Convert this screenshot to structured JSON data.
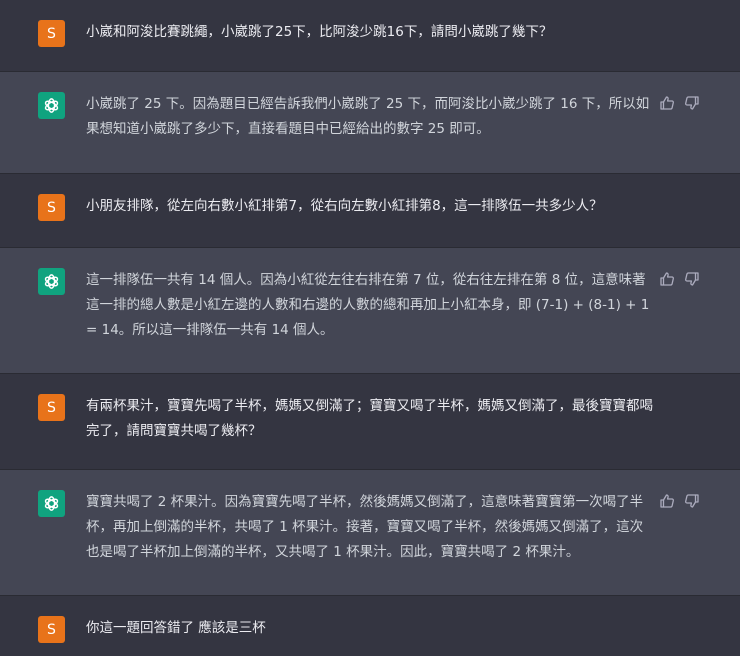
{
  "conversation": {
    "messages": [
      {
        "role": "user",
        "avatar_letter": "S",
        "avatar_color": "#e8731a",
        "text": "小崴和阿浚比賽跳繩，小崴跳了25下，比阿浚少跳16下，請問小崴跳了幾下？"
      },
      {
        "role": "assistant",
        "avatar_icon": "openai-logo-icon",
        "avatar_color": "#10a37f",
        "text": "小崴跳了 25 下。因為題目已經告訴我們小崴跳了 25 下，而阿浚比小崴少跳了 16 下，所以如果想知道小崴跳了多少下，直接看題目中已經給出的數字 25 即可。"
      },
      {
        "role": "user",
        "avatar_letter": "S",
        "avatar_color": "#e8731a",
        "text": "小朋友排隊，從左向右數小紅排第7，從右向左數小紅排第8，這一排隊伍一共多少人？"
      },
      {
        "role": "assistant",
        "avatar_icon": "openai-logo-icon",
        "avatar_color": "#10a37f",
        "text": "這一排隊伍一共有 14 個人。因為小紅從左往右排在第 7 位，從右往左排在第 8 位，這意味著這一排的總人數是小紅左邊的人數和右邊的人數的總和再加上小紅本身，即 (7-1) + (8-1) + 1 = 14。所以這一排隊伍一共有 14 個人。"
      },
      {
        "role": "user",
        "avatar_letter": "S",
        "avatar_color": "#e8731a",
        "text": "有兩杯果汁，寶寶先喝了半杯，媽媽又倒滿了；寶寶又喝了半杯，媽媽又倒滿了，最後寶寶都喝完了，請問寶寶共喝了幾杯？"
      },
      {
        "role": "assistant",
        "avatar_icon": "openai-logo-icon",
        "avatar_color": "#10a37f",
        "text": "寶寶共喝了 2 杯果汁。因為寶寶先喝了半杯，然後媽媽又倒滿了，這意味著寶寶第一次喝了半杯，再加上倒滿的半杯，共喝了 1 杯果汁。接著，寶寶又喝了半杯，然後媽媽又倒滿了，這次也是喝了半杯加上倒滿的半杯，又共喝了 1 杯果汁。因此，寶寶共喝了 2 杯果汁。"
      },
      {
        "role": "user",
        "avatar_letter": "S",
        "avatar_color": "#e8731a",
        "text": "你這一題回答錯了 應該是三杯"
      }
    ],
    "feedback_icons": [
      "thumbs-up-icon",
      "thumbs-down-icon"
    ]
  }
}
